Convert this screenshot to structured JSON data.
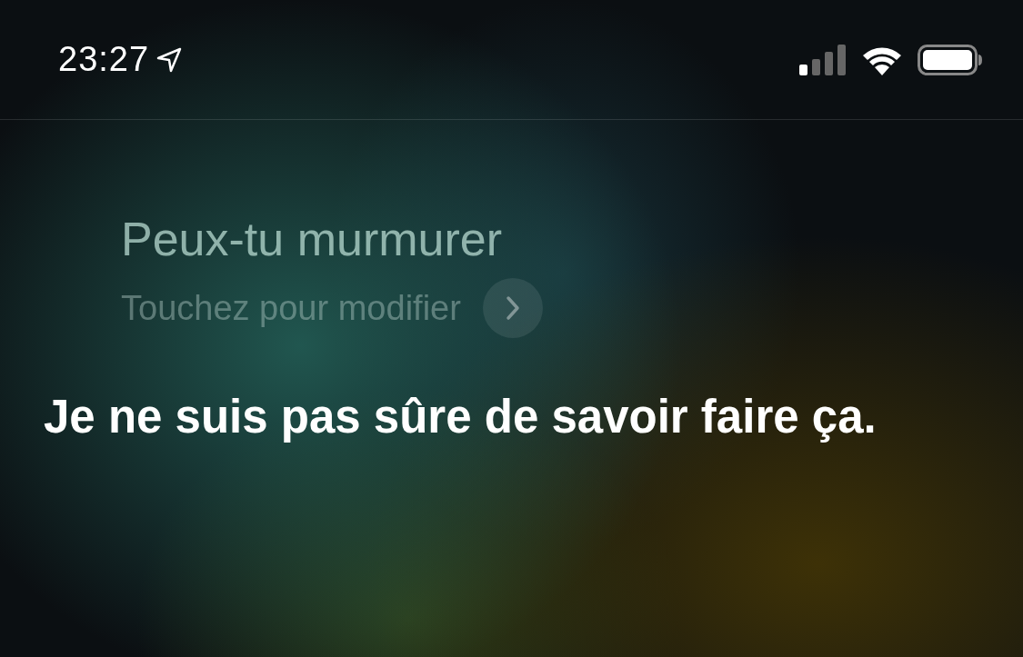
{
  "status_bar": {
    "time": "23:27"
  },
  "query": {
    "text": "Peux-tu murmurer",
    "hint": "Touchez pour modifier"
  },
  "response": {
    "text": "Je ne suis pas sûre de savoir faire ça."
  }
}
